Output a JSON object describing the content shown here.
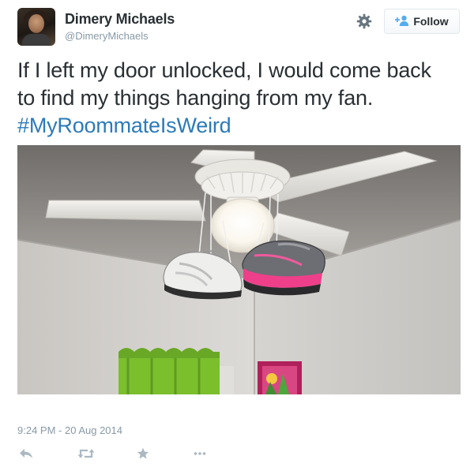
{
  "user": {
    "display_name": "Dimery Michaels",
    "handle": "@DimeryMichaels",
    "avatar_icon": "profile-photo"
  },
  "header": {
    "settings_icon": "gear-icon",
    "follow_label": "Follow",
    "follow_icon": "add-person-icon"
  },
  "tweet": {
    "lines": [
      "If I left my door unlocked, I would come back",
      "to find my things hanging from my fan."
    ],
    "hashtag": "#MyRoommateIsWeird"
  },
  "media": {
    "description_icon": "photo-ceiling-fan-with-shoes"
  },
  "footer": {
    "timestamp": "9:24 PM - 20 Aug 2014",
    "actions": [
      "reply-icon",
      "retweet-icon",
      "favorite-icon",
      "more-icon"
    ]
  },
  "colors": {
    "link": "#2b7bb9",
    "muted": "#8899a6",
    "text": "#292f33",
    "icon": "#aab8c2"
  }
}
